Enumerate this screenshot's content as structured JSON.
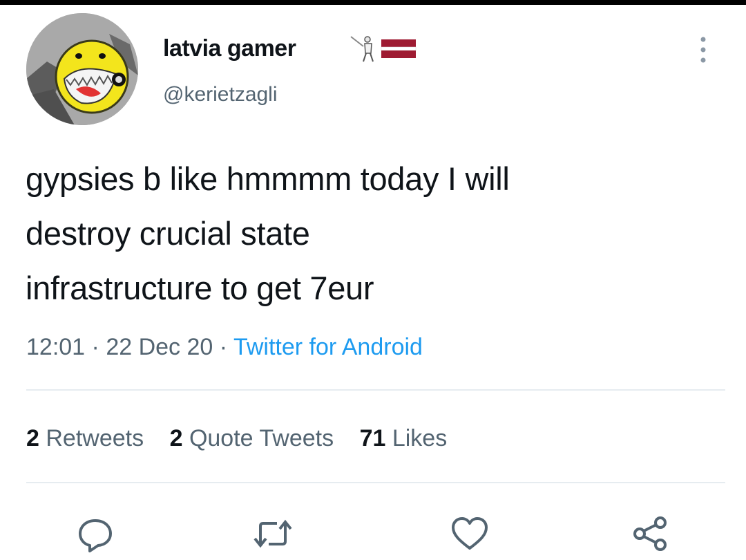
{
  "author": {
    "display_name": "latvia gamer",
    "handle": "@kerietzagli",
    "avatar_icon": "yellow-monster-avatar",
    "name_emojis": [
      "fencer-icon",
      "latvia-flag-icon"
    ]
  },
  "tweet": {
    "text_lines": [
      "gypsies b like hmmmm today I will",
      "destroy crucial state",
      "infrastructure to get 7eur"
    ],
    "time": "12:01",
    "date": "22 Dec 20",
    "source": "Twitter for Android"
  },
  "stats": {
    "retweets_count": "2",
    "retweets_label": "Retweets",
    "quotes_count": "2",
    "quotes_label": "Quote Tweets",
    "likes_count": "71",
    "likes_label": "Likes"
  },
  "actions": {
    "reply_icon": "reply-icon",
    "retweet_icon": "retweet-icon",
    "like_icon": "heart-icon",
    "share_icon": "share-icon"
  },
  "colors": {
    "text": "#0f1419",
    "muted": "#536471",
    "link": "#1d9bf0",
    "divider": "#e6ecf0"
  }
}
